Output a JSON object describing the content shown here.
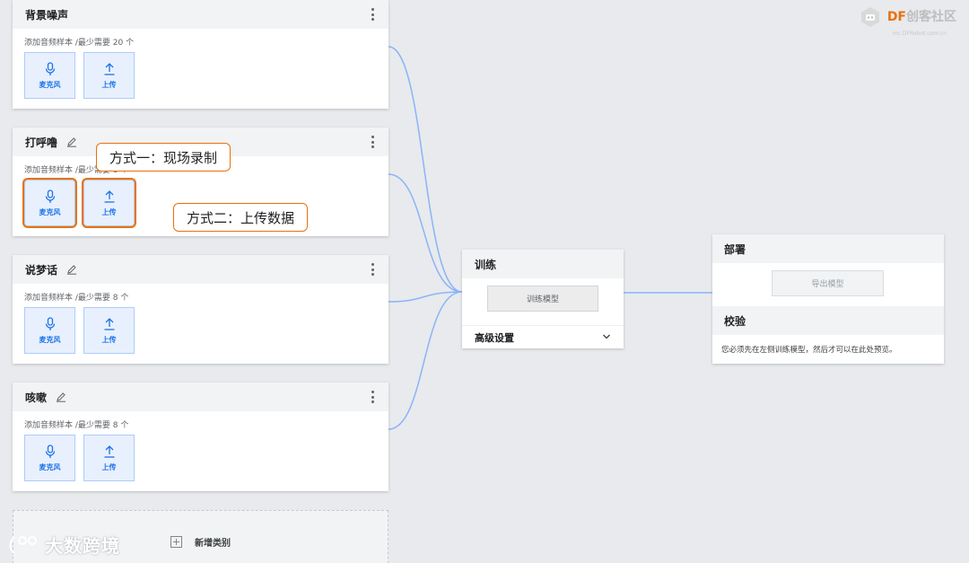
{
  "classes": [
    {
      "title": "背景噪声",
      "hint": "添加音频样本 /最少需要 20 个",
      "mic_label": "麦克风",
      "upload_label": "上传",
      "editable": false
    },
    {
      "title": "打呼噜",
      "hint": "添加音频样本 /最少需要 8 个",
      "mic_label": "麦克风",
      "upload_label": "上传",
      "editable": true
    },
    {
      "title": "说梦话",
      "hint": "添加音频样本 /最少需要 8 个",
      "mic_label": "麦克风",
      "upload_label": "上传",
      "editable": true
    },
    {
      "title": "咳嗽",
      "hint": "添加音频样本 /最少需要 8 个",
      "mic_label": "麦克风",
      "upload_label": "上传",
      "editable": true
    }
  ],
  "add_class": {
    "label": "新增类别"
  },
  "callouts": {
    "record": "方式一：现场录制",
    "upload": "方式二：上传数据"
  },
  "training": {
    "title": "训练",
    "button": "训练模型",
    "advanced": "高级设置"
  },
  "deploy": {
    "title": "部署",
    "export_button": "导出模型",
    "verify_title": "校验",
    "verify_text": "您必须先在左侧训练模型，然后才可以在此处预览。"
  },
  "branding": {
    "logo_df": "DF",
    "logo_rest": "创客社区",
    "logo_sub": "mc.DFRobot.com.cn",
    "watermark": "大数跨境"
  },
  "colors": {
    "accent": "#1a73e8",
    "highlight": "#e8710a",
    "connector": "#8ab4f8"
  }
}
